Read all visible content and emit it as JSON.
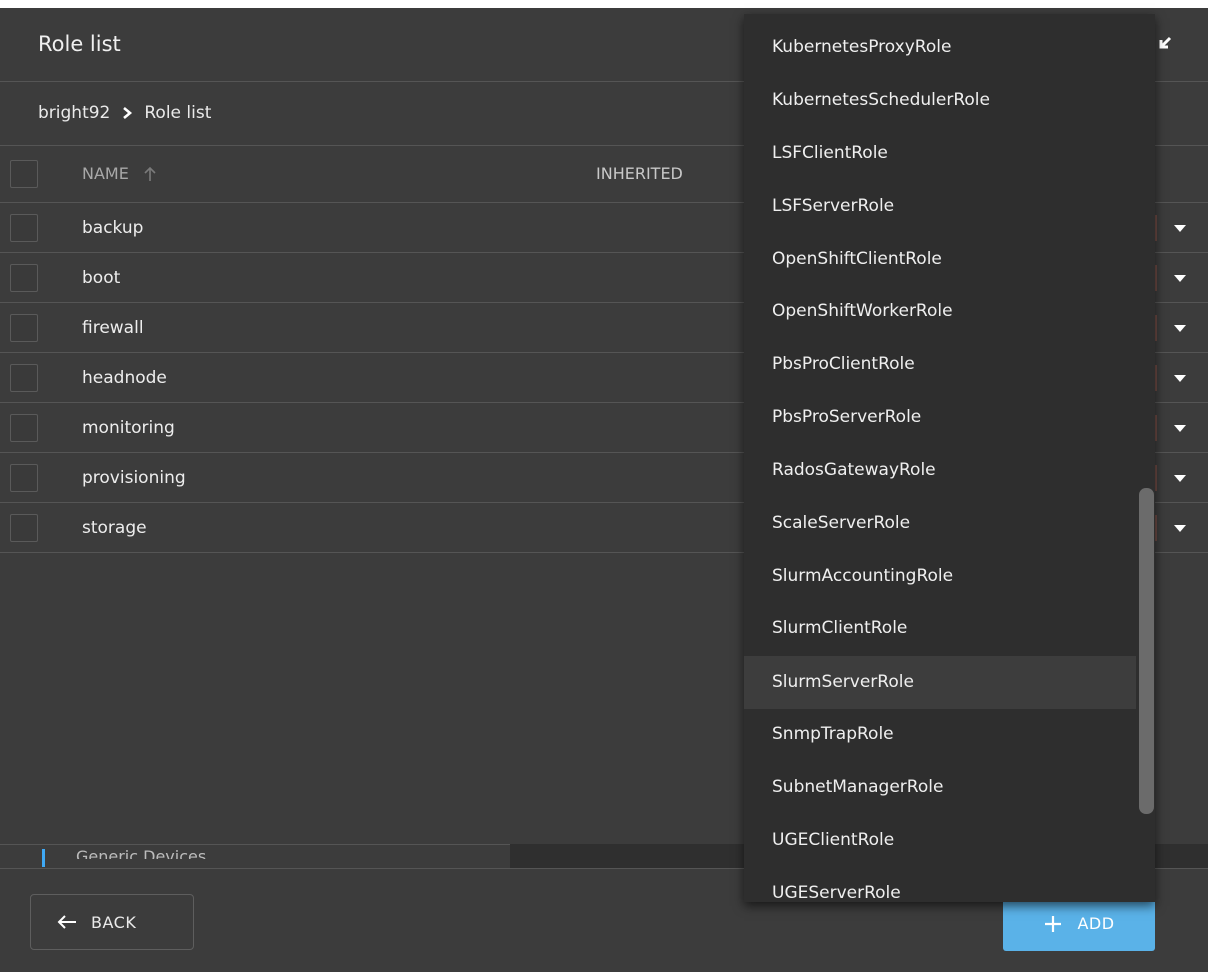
{
  "header": {
    "title": "Role list"
  },
  "breadcrumb": {
    "root": "bright92",
    "current": "Role list"
  },
  "table": {
    "columns": {
      "name": "NAME",
      "inherited": "INHERITED"
    },
    "rows": [
      {
        "name": "backup"
      },
      {
        "name": "boot"
      },
      {
        "name": "firewall"
      },
      {
        "name": "headnode"
      },
      {
        "name": "monitoring"
      },
      {
        "name": "provisioning"
      },
      {
        "name": "storage"
      }
    ]
  },
  "partial_list": {
    "label": "Generic Devices"
  },
  "footer": {
    "back_label": "BACK",
    "add_label": "ADD"
  },
  "dropdown": {
    "items": [
      "KubernetesProxyRole",
      "KubernetesSchedulerRole",
      "LSFClientRole",
      "LSFServerRole",
      "OpenShiftClientRole",
      "OpenShiftWorkerRole",
      "PbsProClientRole",
      "PbsProServerRole",
      "RadosGatewayRole",
      "ScaleServerRole",
      "SlurmAccountingRole",
      "SlurmClientRole",
      "SlurmServerRole",
      "SnmpTrapRole",
      "SubnetManagerRole",
      "UGEClientRole",
      "UGEServerRole"
    ],
    "highlighted": "SlurmServerRole"
  },
  "colors": {
    "accent": "#5ab2e8",
    "background": "#3c3c3c",
    "dropdown_bg": "#2e2e2e"
  },
  "icons": {
    "shrink": "collapse-icon",
    "breadcrumb_sep": "chevron-right-icon",
    "sort": "arrow-up-icon",
    "row_menu": "caret-down-icon",
    "back": "arrow-left-icon",
    "add": "plus-icon"
  }
}
